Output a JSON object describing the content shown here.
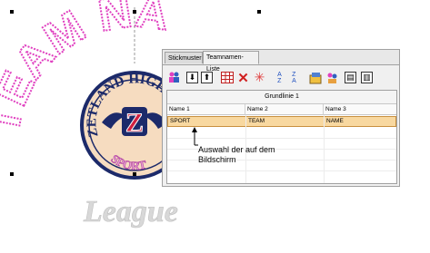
{
  "tabs": [
    {
      "label": "Stickmuster",
      "active": false
    },
    {
      "label": "Teamnamen-Liste",
      "active": true
    }
  ],
  "toolbar_icons": [
    "add-team-member-icon",
    "move-down-icon",
    "move-up-icon",
    "grid-icon",
    "delete-icon",
    "highlight-icon",
    "sort-ascending-icon",
    "sort-descending-icon",
    "import-icon",
    "export-icon",
    "properties-icon",
    "print-icon"
  ],
  "table": {
    "group_header": "Grundlinie 1",
    "columns": [
      "Name 1",
      "Name 2",
      "Name 3"
    ],
    "rows": [
      [
        "SPORT",
        "TEAM",
        "NAME"
      ]
    ]
  },
  "callout": {
    "line1": "Auswahl der auf dem",
    "line2": "Bildschirm"
  },
  "colors": {
    "pink": "#e040c0",
    "navy": "#1c2a6a",
    "cream": "#f6dcc0",
    "selected_row": "#f8d8a0"
  }
}
